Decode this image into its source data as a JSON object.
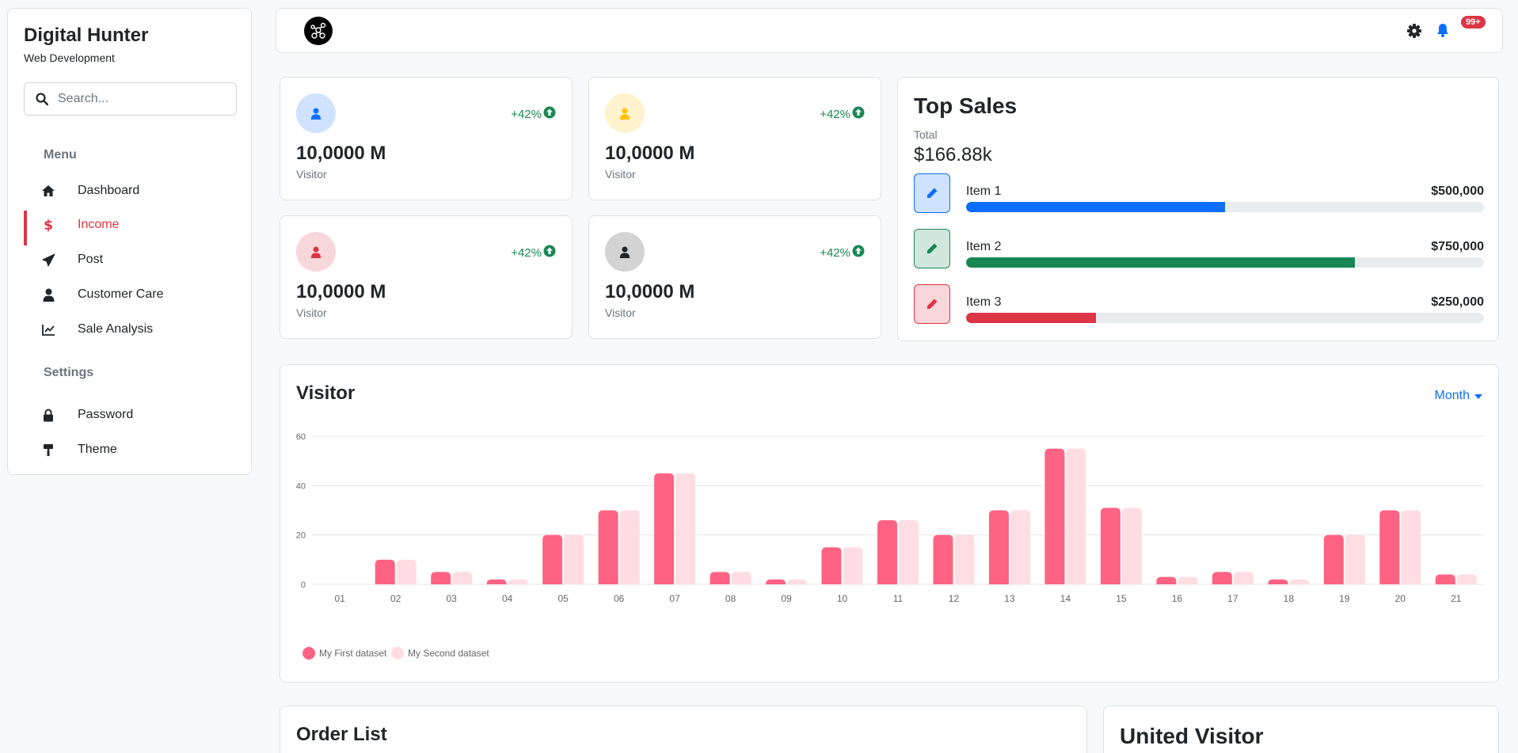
{
  "sidebar": {
    "brand_title": "Digital Hunter",
    "brand_subtitle": "Web Development",
    "search_placeholder": "Search...",
    "menu_heading": "Menu",
    "menu_items": [
      {
        "label": "Dashboard",
        "icon": "home-icon"
      },
      {
        "label": "Income",
        "icon": "dollar-icon",
        "active": true
      },
      {
        "label": "Post",
        "icon": "paper-plane-icon"
      },
      {
        "label": "Customer Care",
        "icon": "user-icon"
      },
      {
        "label": "Sale Analysis",
        "icon": "line-chart-icon"
      }
    ],
    "settings_heading": "Settings",
    "settings_items": [
      {
        "label": "Password",
        "icon": "lock-icon"
      },
      {
        "label": "Theme",
        "icon": "paint-roller-icon"
      }
    ]
  },
  "header": {
    "logo_icon": "network-logo-icon",
    "notification_count": "99+"
  },
  "stats": [
    {
      "value": "10,0000 M",
      "label": "Visitor",
      "change": "+42%",
      "color": "#0d6efd",
      "bg": "#cfe2ff"
    },
    {
      "value": "10,0000 M",
      "label": "Visitor",
      "change": "+42%",
      "color": "#ffc107",
      "bg": "#fff3cd"
    },
    {
      "value": "10,0000 M",
      "label": "Visitor",
      "change": "+42%",
      "color": "#dc3545",
      "bg": "#f8d7da"
    },
    {
      "value": "10,0000 M",
      "label": "Visitor",
      "change": "+42%",
      "color": "#212529",
      "bg": "#d3d3d4"
    }
  ],
  "top_sales": {
    "title": "Top Sales",
    "total_label": "Total",
    "total_value": "$166.88k",
    "items": [
      {
        "name": "Item 1",
        "amount": "$500,000",
        "progress": 0.5,
        "color": "#0d6efd",
        "bg": "#cfe2ff"
      },
      {
        "name": "Item 2",
        "amount": "$750,000",
        "progress": 0.75,
        "color": "#198754",
        "bg": "#d1e7dd"
      },
      {
        "name": "Item 3",
        "amount": "$250,000",
        "progress": 0.25,
        "color": "#dc3545",
        "bg": "#f8d7da"
      }
    ]
  },
  "visitor": {
    "title": "Visitor",
    "filter_label": "Month"
  },
  "order_list": {
    "title": "Order List"
  },
  "united_visitor": {
    "title": "United Visitor"
  },
  "chart_data": {
    "type": "bar",
    "categories": [
      "01",
      "02",
      "03",
      "04",
      "05",
      "06",
      "07",
      "08",
      "09",
      "10",
      "11",
      "12",
      "13",
      "14",
      "15",
      "16",
      "17",
      "18",
      "19",
      "20",
      "21"
    ],
    "series": [
      {
        "name": "My First dataset",
        "color": "#ff6384",
        "values": [
          0,
          10,
          5,
          2,
          20,
          30,
          45,
          5,
          2,
          15,
          26,
          20,
          30,
          55,
          31,
          3,
          5,
          2,
          20,
          30,
          4
        ]
      },
      {
        "name": "My Second dataset",
        "color": "#ffdde3",
        "values": [
          0,
          10,
          5,
          2,
          20,
          30,
          45,
          5,
          2,
          15,
          26,
          20,
          30,
          55,
          31,
          3,
          5,
          2,
          20,
          30,
          4
        ]
      }
    ],
    "yticks": [
      0,
      20,
      40,
      60
    ],
    "ylim": [
      0,
      60
    ],
    "legend": "bottom-left",
    "grid": true
  }
}
